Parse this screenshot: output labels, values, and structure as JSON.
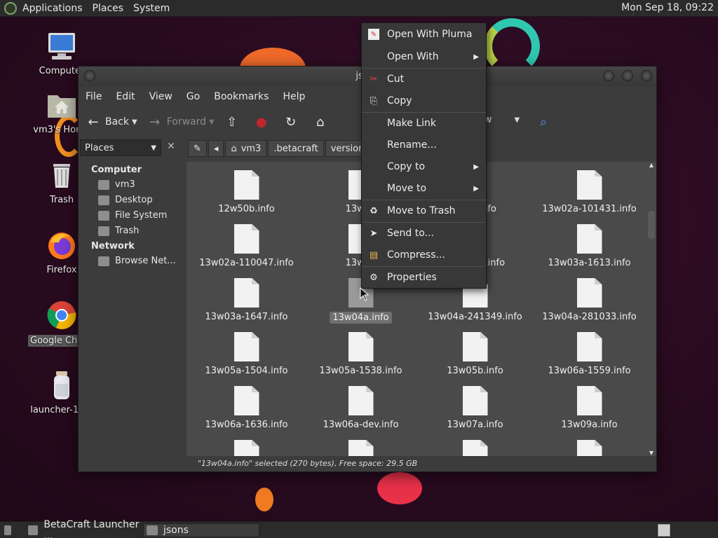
{
  "top_panel": {
    "menus": [
      "Applications",
      "Places",
      "System"
    ],
    "clock": "Mon Sep 18, 09:22"
  },
  "desktop": {
    "icons": [
      "Computer",
      "vm3's Home",
      "Trash",
      "Firefox",
      "Google Chrome",
      "launcher-1.09"
    ]
  },
  "window": {
    "title": "jsons",
    "menu": [
      "File",
      "Edit",
      "View",
      "Go",
      "Bookmarks",
      "Help"
    ],
    "toolbar": {
      "back": "Back",
      "forward": "Forward",
      "view_label": "w"
    },
    "sidebar": {
      "combo": "Places",
      "computer_header": "Computer",
      "computer_items": [
        "vm3",
        "Desktop",
        "File System",
        "Trash"
      ],
      "network_header": "Network",
      "network_items": [
        "Browse Net..."
      ]
    },
    "path": [
      "vm3",
      ".betacraft",
      "versions"
    ],
    "files": [
      "12w50b.info",
      "13w01",
      "",
      "13w02a-101431.info",
      "13w02a-110047.info",
      "13w02",
      "16.info",
      "13w03a-1613.info",
      "13w03a-1647.info",
      "13w04a.info",
      "13w04a-241349.info",
      "13w04a-281033.info",
      "13w05a-1504.info",
      "13w05a-1538.info",
      "13w05b.info",
      "13w06a-1559.info",
      "13w06a-1636.info",
      "13w06a-dev.info",
      "13w07a.info",
      "13w09a.info"
    ],
    "partial_file_3": "nfo",
    "status": "\"13w04a.info\" selected (270 bytes), Free space: 29.5 GB"
  },
  "context_menu": {
    "items": [
      "Open With Pluma",
      "Open With",
      "Cut",
      "Copy",
      "Make Link",
      "Rename...",
      "Copy to",
      "Move to",
      "Move to Trash",
      "Send to...",
      "Compress...",
      "Properties"
    ]
  },
  "taskbar": {
    "tasks": [
      "BetaCraft Launcher ...",
      "jsons"
    ]
  }
}
